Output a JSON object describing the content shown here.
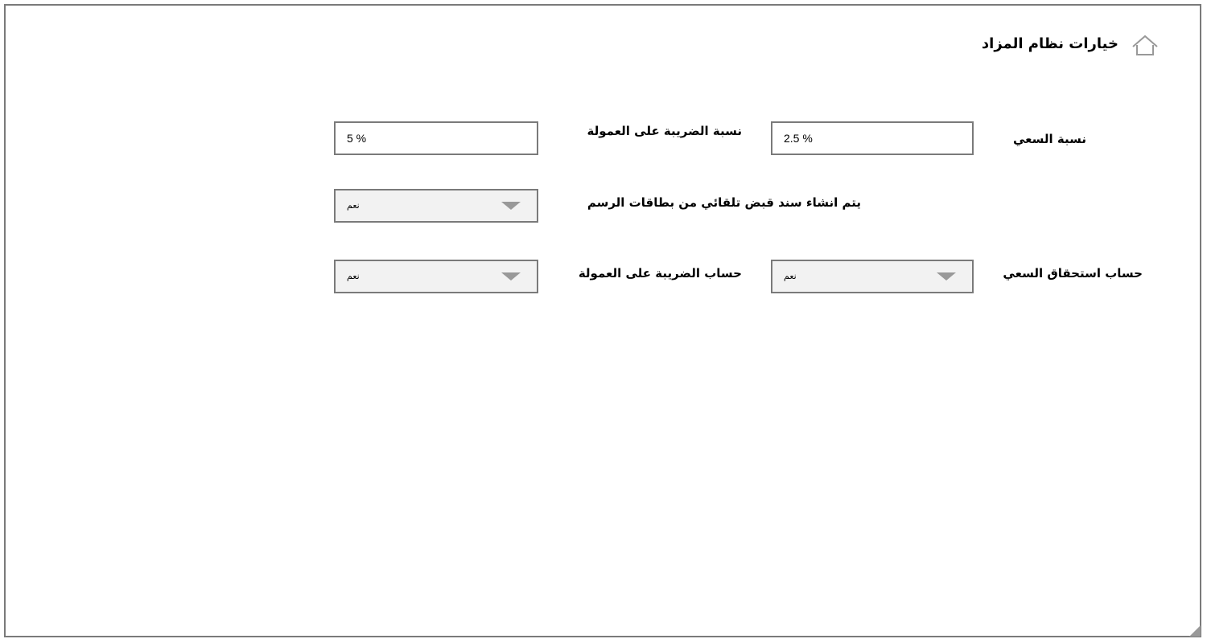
{
  "header": {
    "title": "خيارات نظام المزاد",
    "home_icon": "home-icon"
  },
  "fields": {
    "commission_rate": {
      "label": "نسبة السعي",
      "value": "2.5 %"
    },
    "tax_on_commission_rate": {
      "label": "نسبة الضريبة على العمولة",
      "value": "5 %"
    },
    "auto_receipt": {
      "label": "يتم انشاء سند قبض تلقائي من بطاقات الرسم",
      "selected": "نعم"
    },
    "commission_due": {
      "label": "حساب استحقاق السعي",
      "selected": "نعم"
    },
    "tax_on_commission": {
      "label": "حساب الضريبة على العمولة",
      "selected": "نعم"
    }
  },
  "colors": {
    "border": "#7a7a7a",
    "select_bg": "#f2f2f2",
    "chevron": "#999999"
  }
}
